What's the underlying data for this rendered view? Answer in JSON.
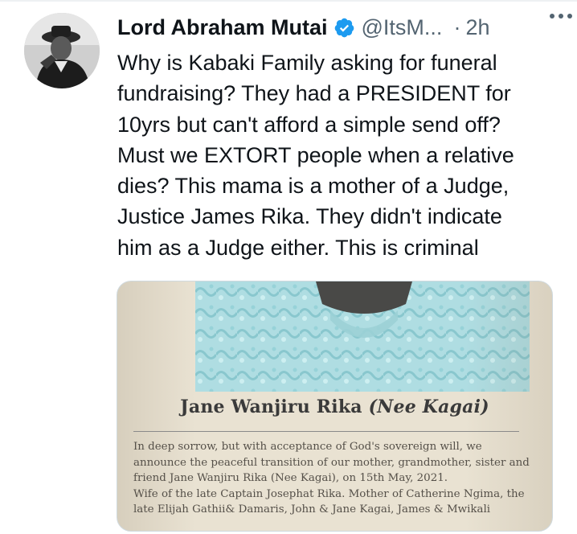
{
  "tweet": {
    "author_name": "Lord Abraham Mutai",
    "handle": "@ItsM...",
    "separator": "·",
    "time": "2h",
    "text": "Why is Kabaki Family asking for funeral\nfundraising? They had a PRESIDENT for\n10yrs but can't afford a simple send off?\nMust we EXTORT people when a relative\ndies? This mama is a mother of a Judge,\nJustice James Rika. They didn't indicate\nhim as a Judge either. This is criminal"
  },
  "media": {
    "notice_name": "Jane Wanjiru Rika",
    "notice_nee": "(Nee Kagai)",
    "paragraph_1": "In deep sorrow, but with acceptance of God's sovereign will, we announce the peaceful transition of our mother, grandmother, sister and friend Jane Wanjiru Rika (Nee Kagai), on 15th May, 2021.",
    "paragraph_2": "Wife of the late Captain Josephat Rika. Mother of Catherine Ngima, the late Elijah Gathii& Damaris, John & Jane Kagai, James & Mwikali"
  },
  "icons": {
    "verified": "verified-badge-icon",
    "more": "more-options-icon"
  },
  "colors": {
    "primary_text": "#0f1419",
    "secondary_text": "#536471",
    "verified_blue": "#1d9bf0",
    "border": "#cfd9de"
  }
}
